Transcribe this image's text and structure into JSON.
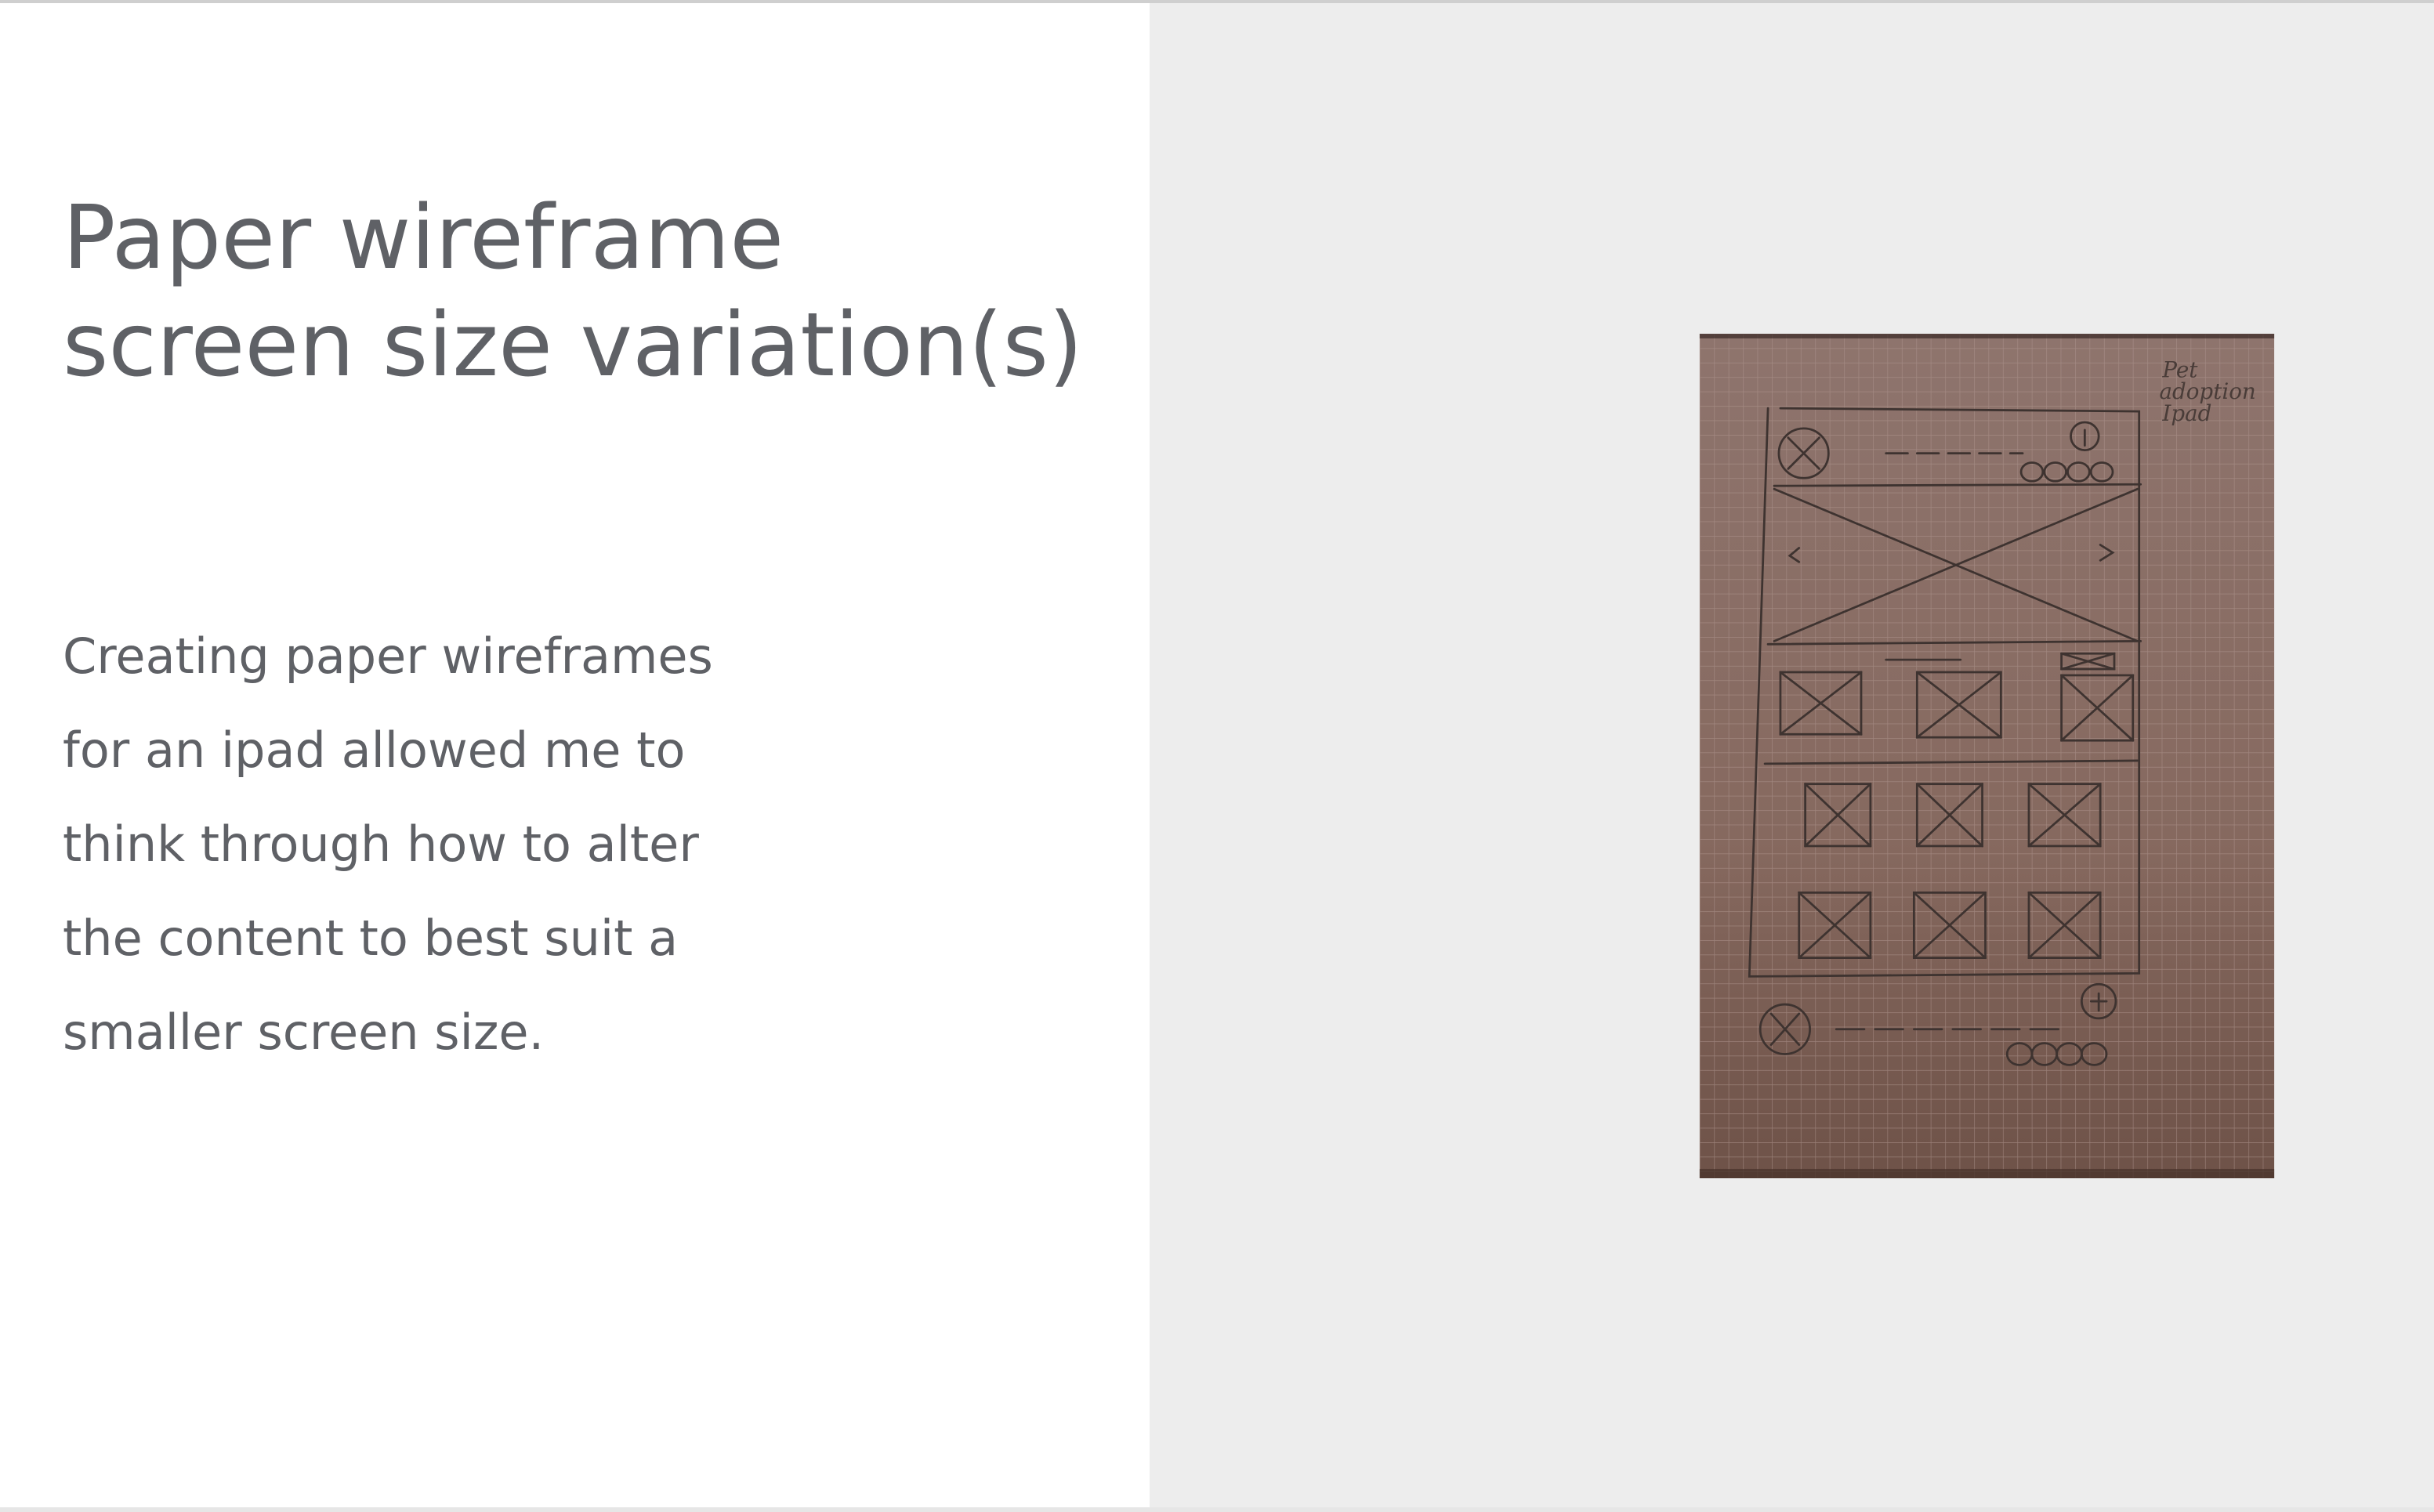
{
  "slide": {
    "title_lines": [
      "Paper wireframe",
      "screen size variation(s)"
    ],
    "body_lines": [
      "Creating paper wireframes",
      "for an ipad allowed me to",
      "think through how to alter",
      "the content to best suit a",
      "smaller screen size."
    ],
    "photo": {
      "handwritten_note_lines": [
        "Pet",
        "adoption",
        "Ipad"
      ]
    }
  },
  "colors": {
    "text": "#5f6166",
    "left_background": "#ffffff",
    "right_background": "#ededed",
    "paper": "#8a7068",
    "pencil": "#3e3330"
  }
}
